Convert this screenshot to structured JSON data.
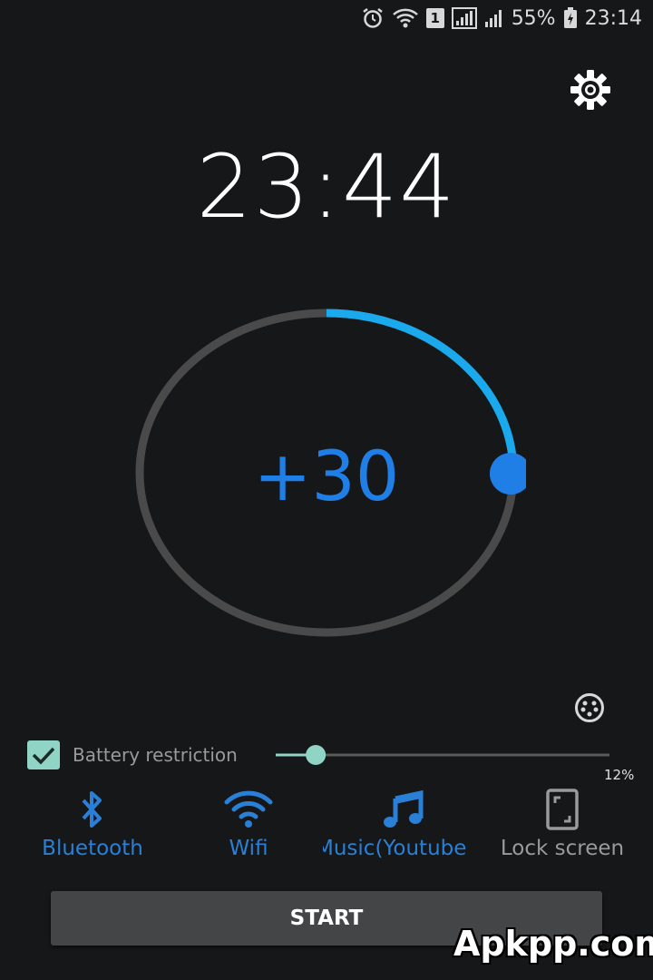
{
  "status_bar": {
    "sim_badge": "1",
    "battery_percent": "55%",
    "time": "23:14",
    "icons": [
      "alarm-icon",
      "wifi-icon",
      "sim-icon",
      "signal-icon",
      "signal-icon",
      "battery-charging-icon"
    ]
  },
  "header": {
    "settings_icon": "gear-icon"
  },
  "timer": {
    "end_time": "23:44",
    "offset_label": "+30",
    "dial_progress": 0.25,
    "colors": {
      "progress": "#19a9ec",
      "track": "#4a4a4a",
      "knob": "#1f7fe6",
      "offset_text": "#1f7fe6"
    }
  },
  "extra_icon": "smiley-icon",
  "battery_restriction": {
    "checked": true,
    "label": "Battery restriction",
    "slider_value": 0.12,
    "percent_label": "12%",
    "color": "#8fd4c4"
  },
  "options": [
    {
      "id": "bluetooth",
      "label": "Bluetooth",
      "icon": "bluetooth-icon",
      "active": true
    },
    {
      "id": "wifi",
      "label": "Wifi",
      "icon": "wifi-icon",
      "active": true
    },
    {
      "id": "music",
      "label": "Music(Youtube",
      "icon": "music-note-icon",
      "active": true
    },
    {
      "id": "lock",
      "label": "Lock screen",
      "icon": "phone-icon",
      "active": false
    }
  ],
  "colors": {
    "active": "#2a7fd6",
    "inactive": "#9a9a9a",
    "background": "#161719"
  },
  "start_button": {
    "label": "START"
  },
  "watermark": "Apkpp.com"
}
